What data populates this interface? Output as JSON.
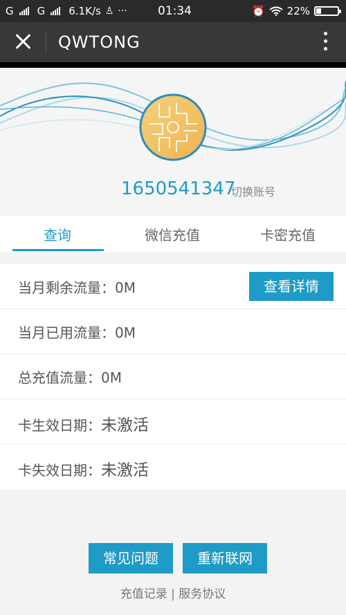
{
  "status_bar": {
    "carrier1": "G",
    "carrier2": "G",
    "speed": "6.1K/s",
    "time": "01:34",
    "battery": "22%",
    "battery_level": 0.22
  },
  "app_bar": {
    "title": "QWTONG"
  },
  "header": {
    "account": "1650541347",
    "switch_label": "切换账号"
  },
  "tabs": [
    {
      "label": "查询",
      "active": true
    },
    {
      "label": "微信充值",
      "active": false
    },
    {
      "label": "卡密充值",
      "active": false
    }
  ],
  "info": {
    "rows": [
      {
        "label": "当月剩余流量：",
        "value": "0M"
      },
      {
        "label": "当月已用流量：",
        "value": "0M"
      },
      {
        "label": "总充值流量：",
        "value": "0M"
      },
      {
        "label": "卡生效日期：",
        "value": "未激活"
      },
      {
        "label": "卡失效日期：",
        "value": "未激活"
      }
    ],
    "detail_button": "查看详情"
  },
  "footer": {
    "faq_button": "常见问题",
    "reconnect_button": "重新联网",
    "link_history": "充值记录",
    "separator": "|",
    "link_terms": "服务协议"
  },
  "colors": {
    "accent": "#1e9bc6",
    "appbar": "#383838",
    "statusbar": "#2a2a2a"
  }
}
